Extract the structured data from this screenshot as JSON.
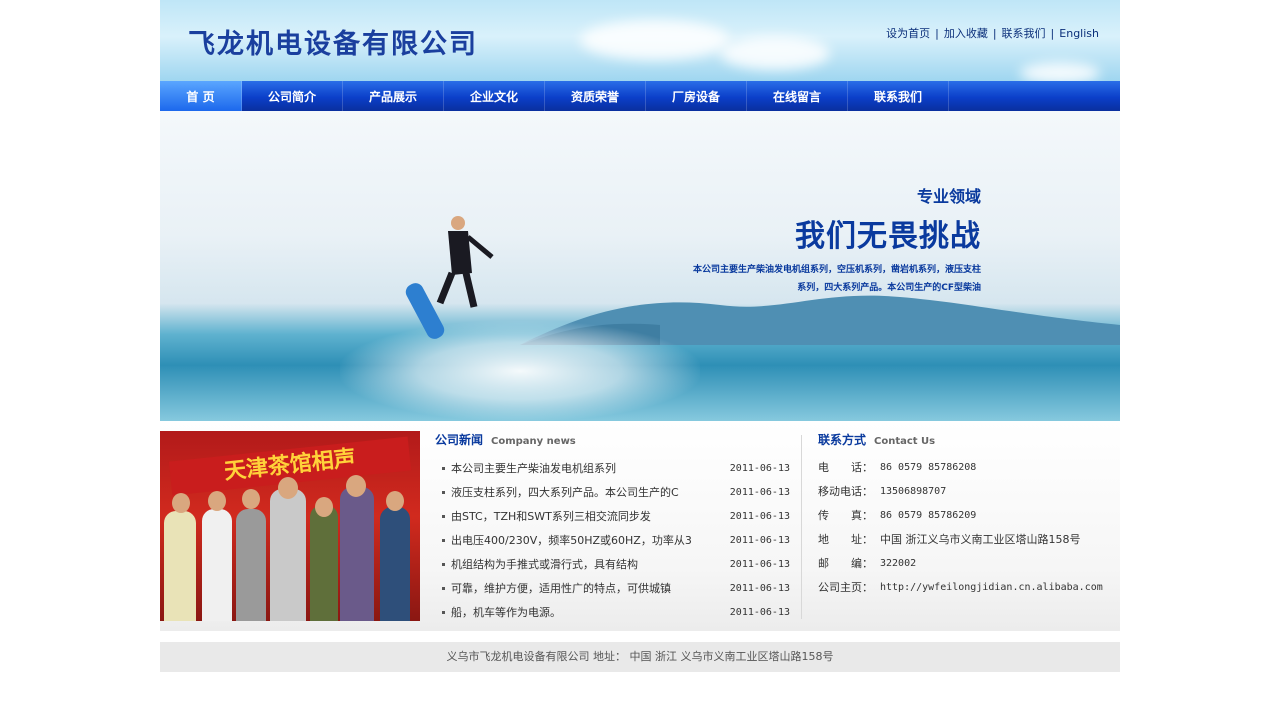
{
  "header": {
    "company_name": "飞龙机电设备有限公司",
    "links": [
      "设为首页",
      "加入收藏",
      "联系我们",
      "English"
    ]
  },
  "nav": {
    "items": [
      "首 页",
      "公司简介",
      "产品展示",
      "企业文化",
      "资质荣誉",
      "厂房设备",
      "在线留言",
      "联系我们"
    ],
    "active_index": 0
  },
  "banner": {
    "line1": "专业领域",
    "line2": "我们无畏挑战",
    "line3": "本公司主要生产柴油发电机组系列，空压机系列，凿岩机系列，液压支柱",
    "line4": "系列，四大系列产品。本公司生产的CF型柴油"
  },
  "photo": {
    "caption_text": "天津茶馆相声"
  },
  "news": {
    "title_cn": "公司新闻",
    "title_en": "Company news",
    "items": [
      {
        "title": "本公司主要生产柴油发电机组系列",
        "date": "2011-06-13"
      },
      {
        "title": "液压支柱系列，四大系列产品。本公司生产的C",
        "date": "2011-06-13"
      },
      {
        "title": "由STC，TZH和SWT系列三相交流同步发",
        "date": "2011-06-13"
      },
      {
        "title": "出电压400/230V，频率50HZ或60HZ，功率从3",
        "date": "2011-06-13"
      },
      {
        "title": "机组结构为手推式或滑行式，具有结构",
        "date": "2011-06-13"
      },
      {
        "title": "可靠，维护方便，适用性广的特点，可供城镇",
        "date": "2011-06-13"
      },
      {
        "title": "船，机车等作为电源。",
        "date": "2011-06-13"
      }
    ]
  },
  "contact": {
    "title_cn": "联系方式",
    "title_en": "Contact Us",
    "rows": [
      {
        "label": "电　　话：",
        "value": "86 0579 85786208"
      },
      {
        "label": "移动电话：",
        "value": "13506898707"
      },
      {
        "label": "传　　真：",
        "value": "86 0579 85786209"
      },
      {
        "label": "地　　址：",
        "value": "中国 浙江义乌市义南工业区塔山路158号"
      },
      {
        "label": "邮　　编：",
        "value": "322002"
      },
      {
        "label": "公司主页：",
        "value": "http://ywfeilongjidian.cn.alibaba.com"
      }
    ]
  },
  "footer": {
    "text": "义乌市飞龙机电设备有限公司  地址： 中国 浙江  义乌市义南工业区塔山路158号"
  },
  "colors": {
    "brand_blue": "#0a3a9e",
    "nav_blue": "#0b3fc9",
    "footer_bg": "#e9e9e9"
  }
}
